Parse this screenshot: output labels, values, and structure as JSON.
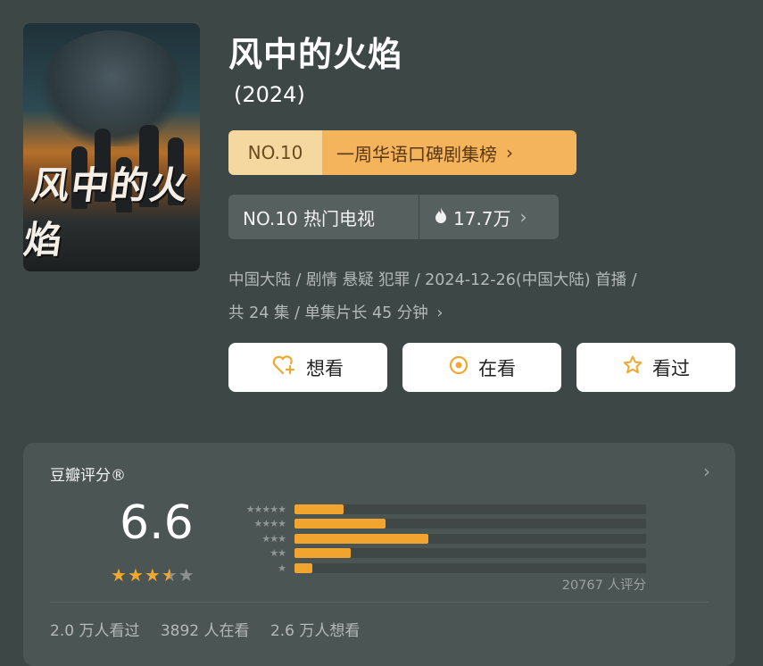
{
  "show": {
    "title": "风中的火焰",
    "year": "(2024)",
    "poster_title": "风中的火焰"
  },
  "ranks": {
    "weekly_no": "NO.10",
    "weekly_label": "一周华语口碑剧集榜",
    "hot_no": "NO.10 热门电视",
    "heat": "17.7万"
  },
  "meta": {
    "line1": "中国大陆 / 剧情 悬疑 犯罪 / 2024-12-26(中国大陆) 首播 /",
    "line2": "共 24 集 / 单集片长 45 分钟"
  },
  "actions": {
    "want": "想看",
    "watching": "在看",
    "watched": "看过"
  },
  "rating": {
    "header": "豆瓣评分®",
    "score": "6.6",
    "stars": 3.5,
    "distribution": [
      {
        "stars": 5,
        "label": "★★★★★",
        "fraction": 0.14
      },
      {
        "stars": 4,
        "label": "★★★★",
        "fraction": 0.26
      },
      {
        "stars": 3,
        "label": "★★★",
        "fraction": 0.38
      },
      {
        "stars": 2,
        "label": "★★",
        "fraction": 0.16
      },
      {
        "stars": 1,
        "label": "★",
        "fraction": 0.05
      }
    ],
    "count": "20767 人评分",
    "watched": "2.0 万人看过",
    "watching": "3892 人在看",
    "want": "2.6 万人想看"
  },
  "colors": {
    "background": "#3d4746",
    "accent": "#f0a830",
    "rank_gold": "#f3b45b"
  }
}
